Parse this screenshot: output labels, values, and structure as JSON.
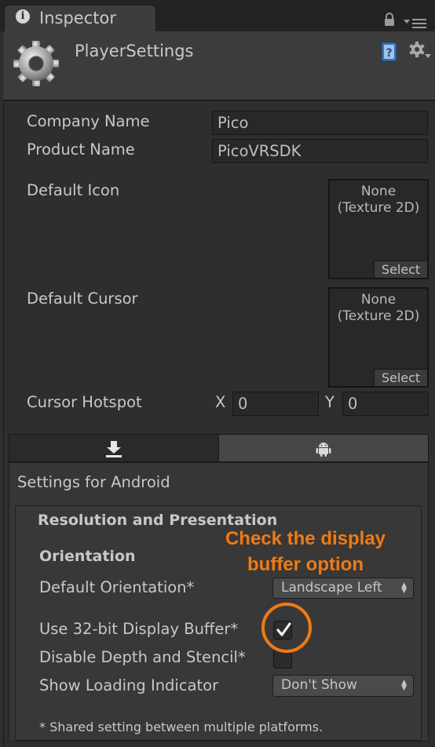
{
  "window": {
    "tab_label": "Inspector",
    "tab_icon": "info-icon",
    "tab_icon_glyph": "i",
    "header_icons": [
      "lock-icon",
      "tab-menu-icon"
    ]
  },
  "header": {
    "title": "PlayerSettings",
    "object_icon": "gear-icon",
    "help_icon": "help-book-icon",
    "settings_icon": "gear-menu-icon"
  },
  "fields": {
    "company_name": {
      "label": "Company Name",
      "value": "Pico"
    },
    "product_name": {
      "label": "Product Name",
      "value": "PicoVRSDK"
    },
    "default_icon": {
      "label": "Default Icon",
      "value_line1": "None",
      "value_line2": "(Texture 2D)",
      "select_label": "Select"
    },
    "default_cursor": {
      "label": "Default Cursor",
      "value_line1": "None",
      "value_line2": "(Texture 2D)",
      "select_label": "Select"
    },
    "cursor_hotspot": {
      "label": "Cursor Hotspot",
      "x_label": "X",
      "x_value": "0",
      "y_label": "Y",
      "y_value": "0"
    }
  },
  "platform_tabs": [
    {
      "icon": "download-icon",
      "selected": true
    },
    {
      "icon": "android-icon",
      "selected": false
    }
  ],
  "android": {
    "settings_title": "Settings for Android",
    "section_title": "Resolution and Presentation",
    "orientation_header": "Orientation",
    "default_orientation": {
      "label": "Default Orientation*",
      "value": "Landscape Left"
    },
    "use_32bit_buffer": {
      "label": "Use 32-bit Display Buffer*",
      "checked": true
    },
    "disable_depth_stencil": {
      "label": "Disable Depth and Stencil*",
      "checked": false
    },
    "show_loading_indicator": {
      "label": "Show Loading Indicator",
      "value": "Don't Show"
    },
    "footnote": "* Shared setting between multiple platforms."
  },
  "annotation": {
    "line1": "Check the display",
    "line2": "buffer option",
    "color": "#f07a14"
  },
  "colors": {
    "panel_bg": "#2e2e2e",
    "header_bg": "#3c3c3c",
    "accent_annotation": "#f07a14"
  }
}
